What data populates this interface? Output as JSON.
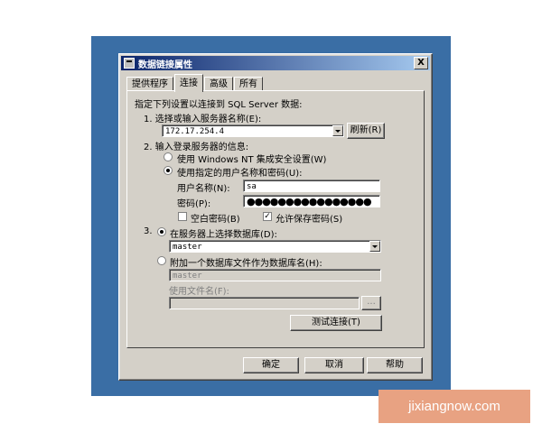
{
  "window": {
    "title": "数据链接属性",
    "close_label": "X"
  },
  "tabs": [
    {
      "label": "提供程序"
    },
    {
      "label": "连接"
    },
    {
      "label": "高级"
    },
    {
      "label": "所有"
    }
  ],
  "connection": {
    "intro": "指定下列设置以连接到 SQL Server 数据:",
    "step1_label": "1. 选择或输入服务器名称(E):",
    "server_value": "172.17.254.4",
    "refresh_label": "刷新(R)",
    "step2_label": "2. 输入登录服务器的信息:",
    "radio_nt_label": "使用 Windows NT 集成安全设置(W)",
    "radio_user_label": "使用指定的用户名称和密码(U):",
    "username_label": "用户名称(N):",
    "username_value": "sa",
    "password_label": "密码(P):",
    "password_value": "●●●●●●●●●●●●●●●●",
    "blank_password_label": "空白密码(B)",
    "save_password_label": "允许保存密码(S)",
    "step3_label": "3.",
    "radio_select_db_label": "在服务器上选择数据库(D):",
    "database_value": "master",
    "radio_attach_label": "附加一个数据库文件作为数据库名(H):",
    "attach_db_value": "master",
    "use_filename_label": "使用文件名(F):",
    "browse_label": "...",
    "test_connection_label": "测试连接(T)"
  },
  "footer": {
    "ok_label": "确定",
    "cancel_label": "取消",
    "help_label": "帮助"
  },
  "watermark": "jixiangnow.com"
}
